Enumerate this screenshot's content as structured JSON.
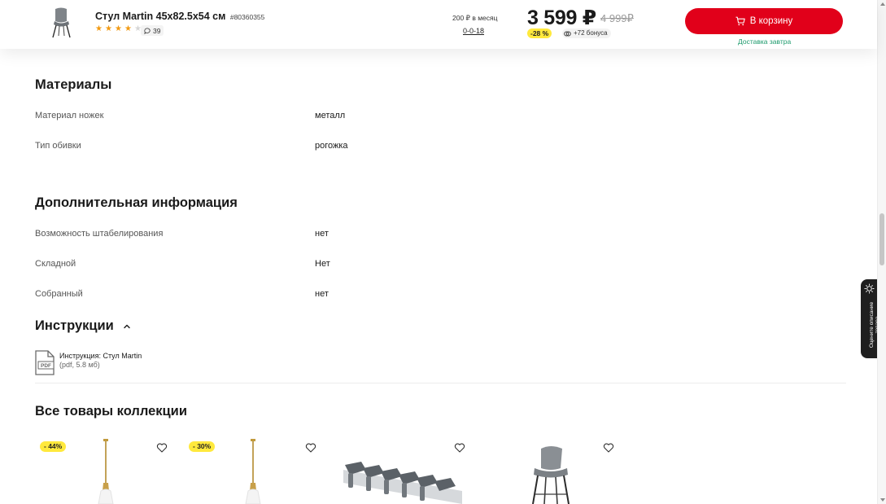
{
  "product": {
    "title": "Стул Martin 45x82.5x54 см",
    "sku": "#80360355",
    "rating": 4,
    "rating_max": 5,
    "reviews_count": "39",
    "monthly_payment": "200 ₽ в месяц",
    "installment_plan": "0-0-18",
    "price": "3 599 ₽",
    "old_price": "4 999₽",
    "discount": "-28 %",
    "bonus": "+72 бонуса",
    "cart_button": "В корзину",
    "delivery": "Доставка завтра"
  },
  "materials": {
    "title": "Материалы",
    "rows": [
      {
        "label": "Материал ножек",
        "value": "металл"
      },
      {
        "label": "Тип обивки",
        "value": "рогожка"
      }
    ]
  },
  "additional": {
    "title": "Дополнительная информация",
    "rows": [
      {
        "label": "Возможность штабелирования",
        "value": "нет"
      },
      {
        "label": "Складной",
        "value": "Нет"
      },
      {
        "label": "Собранный",
        "value": "нет"
      }
    ]
  },
  "instructions": {
    "title": "Инструкции",
    "doc_name": "Инструкция: Стул Martin",
    "doc_meta": "(pdf, 5.8 мб)",
    "icon_text": "PDF"
  },
  "collection": {
    "title": "Все товары коллекции",
    "cards": [
      {
        "discount": "- 44%",
        "image": "pendant-lamp"
      },
      {
        "discount": "- 30%",
        "image": "pendant-lamp"
      },
      {
        "discount": "",
        "image": "wall-hook-rack"
      },
      {
        "discount": "",
        "image": "bar-stool"
      }
    ]
  },
  "side_tab": {
    "label": "Оцените описание товара"
  },
  "colors": {
    "accent": "#e1001a",
    "badge": "#ffe93d",
    "delivery": "#1d9a6c",
    "star": "#f29a12"
  }
}
